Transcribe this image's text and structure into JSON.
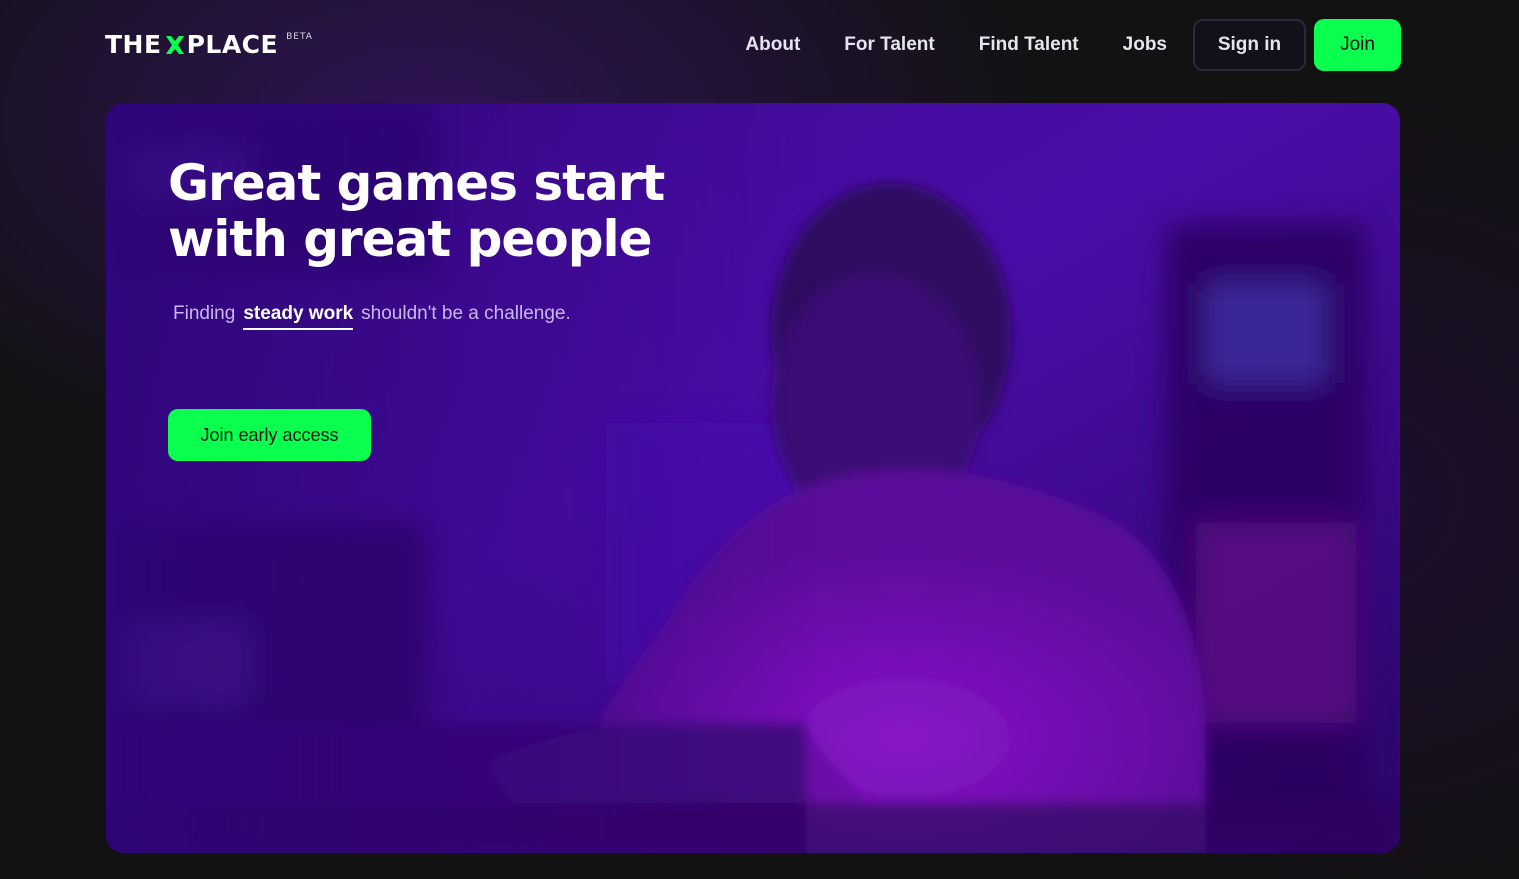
{
  "header": {
    "logo": {
      "left_word": "THE",
      "right_word": "PLACE",
      "badge": "BETA",
      "icon": "x-logo-icon",
      "accent": "#0aff4e"
    },
    "nav": {
      "about": "About",
      "for_talent": "For Talent",
      "find_talent": "Find Talent",
      "jobs": "Jobs"
    },
    "sign_in_label": "Sign in",
    "join_label": "Join"
  },
  "hero": {
    "title_line1": "Great games start",
    "title_line2": "with great people",
    "subtitle_prefix": "Finding",
    "subtitle_emphasis": "steady work",
    "subtitle_suffix": "shouldn't be a challenge.",
    "cta_label": "Join early access",
    "image_alt": "Person working at a computer desk in purple light"
  },
  "colors": {
    "accent_green": "#0aff4e",
    "hero_purple": "#3a0a8c",
    "page_background": "#121212"
  }
}
